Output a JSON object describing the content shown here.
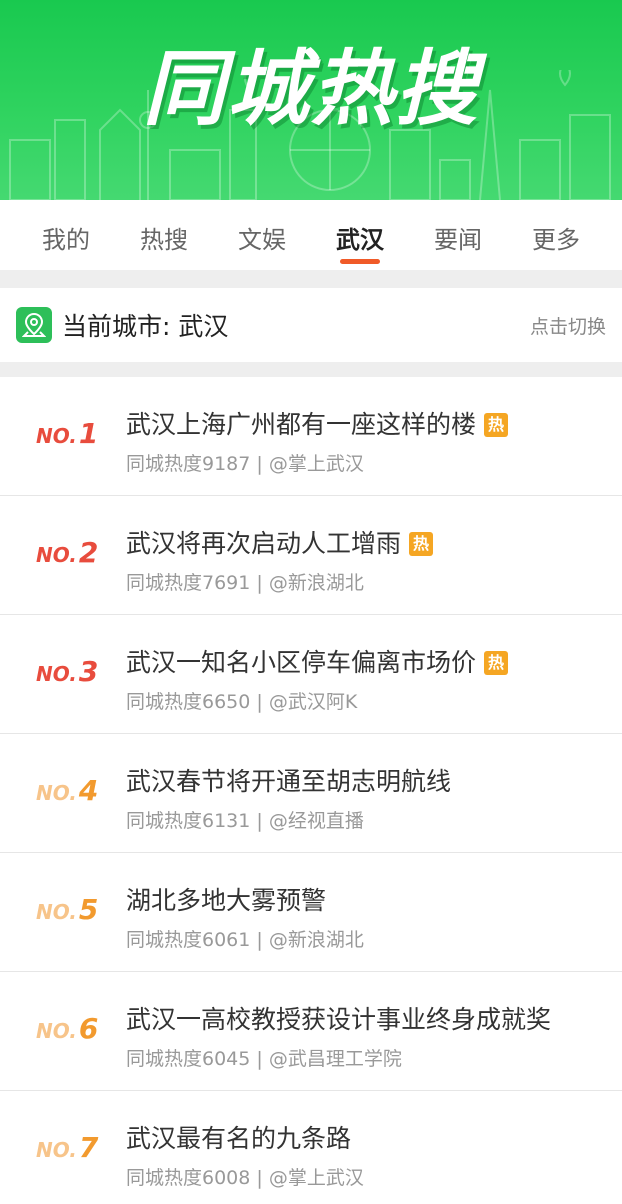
{
  "banner": {
    "title": "同城热搜"
  },
  "tabs": [
    {
      "label": "我的",
      "active": false
    },
    {
      "label": "热搜",
      "active": false
    },
    {
      "label": "文娱",
      "active": false
    },
    {
      "label": "武汉",
      "active": true
    },
    {
      "label": "要闻",
      "active": false
    },
    {
      "label": "更多",
      "active": false
    }
  ],
  "city": {
    "label": "当前城市: 武汉",
    "switch_label": "点击切换",
    "icon": "location-pin-icon"
  },
  "hot_badge": "热",
  "colors": {
    "brand_green": "#2dbf59",
    "accent": "#f05a28",
    "rank_red": "#e84c3d",
    "rank_orange": "#f29a2e",
    "hot_badge": "#f5a623"
  },
  "items": [
    {
      "rank_prefix": "NO.",
      "rank": "1",
      "title": "武汉上海广州都有一座这样的楼",
      "hot": true,
      "meta": "同城热度9187 | @掌上武汉"
    },
    {
      "rank_prefix": "NO.",
      "rank": "2",
      "title": "武汉将再次启动人工增雨",
      "hot": true,
      "meta": "同城热度7691 | @新浪湖北"
    },
    {
      "rank_prefix": "NO.",
      "rank": "3",
      "title": "武汉一知名小区停车偏离市场价",
      "hot": true,
      "meta": "同城热度6650 | @武汉阿K"
    },
    {
      "rank_prefix": "NO.",
      "rank": "4",
      "title": "武汉春节将开通至胡志明航线",
      "hot": false,
      "meta": "同城热度6131 | @经视直播"
    },
    {
      "rank_prefix": "NO.",
      "rank": "5",
      "title": "湖北多地大雾预警",
      "hot": false,
      "meta": "同城热度6061 | @新浪湖北"
    },
    {
      "rank_prefix": "NO.",
      "rank": "6",
      "title": "武汉一高校教授获设计事业终身成就奖",
      "hot": false,
      "meta": "同城热度6045 | @武昌理工学院"
    },
    {
      "rank_prefix": "NO.",
      "rank": "7",
      "title": "武汉最有名的九条路",
      "hot": false,
      "meta": "同城热度6008 | @掌上武汉"
    }
  ]
}
